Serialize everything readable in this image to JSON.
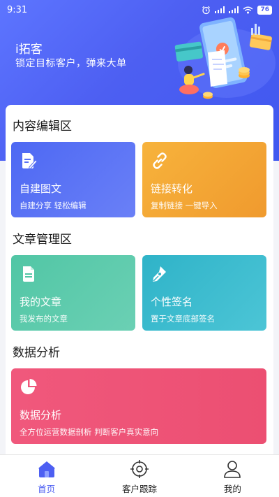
{
  "status_bar": {
    "time": "9:31",
    "battery": "76",
    "icons": [
      "alarm-icon",
      "signal-icon",
      "signal-icon",
      "wifi-icon",
      "battery-icon"
    ]
  },
  "header": {
    "title": "i拓客",
    "subtitle": "锁定目标客户，弹来大单",
    "illustration": "marketing-illustration"
  },
  "sections": {
    "content": {
      "title": "内容编辑区"
    },
    "articles": {
      "title": "文章管理区"
    },
    "analytics": {
      "title": "数据分析"
    }
  },
  "tiles": {
    "create": {
      "title": "自建图文",
      "sub": "自建分享 轻松编辑",
      "icon": "document-edit-icon"
    },
    "link": {
      "title": "链接转化",
      "sub": "复制链接 一键导入",
      "icon": "link-icon"
    },
    "my_articles": {
      "title": "我的文章",
      "sub": "我发布的文章",
      "icon": "document-icon"
    },
    "signature": {
      "title": "个性签名",
      "sub": "置于文章底部签名",
      "icon": "pen-nib-icon"
    },
    "analytics": {
      "title": "数据分析",
      "sub": "全方位运营数据剖析 判断客户真实意向",
      "icon": "pie-chart-icon"
    }
  },
  "nav": {
    "home": {
      "label": "首页",
      "icon": "home-icon"
    },
    "tracking": {
      "label": "客户跟踪",
      "icon": "target-icon"
    },
    "mine": {
      "label": "我的",
      "icon": "user-icon"
    }
  },
  "colors": {
    "brand": "#4d5ff2",
    "tile_blue": "#4d68f3",
    "tile_orange": "#f09a2e",
    "tile_green": "#51c6a5",
    "tile_cyan": "#2fb3c8",
    "tile_pink": "#ec4f72"
  }
}
